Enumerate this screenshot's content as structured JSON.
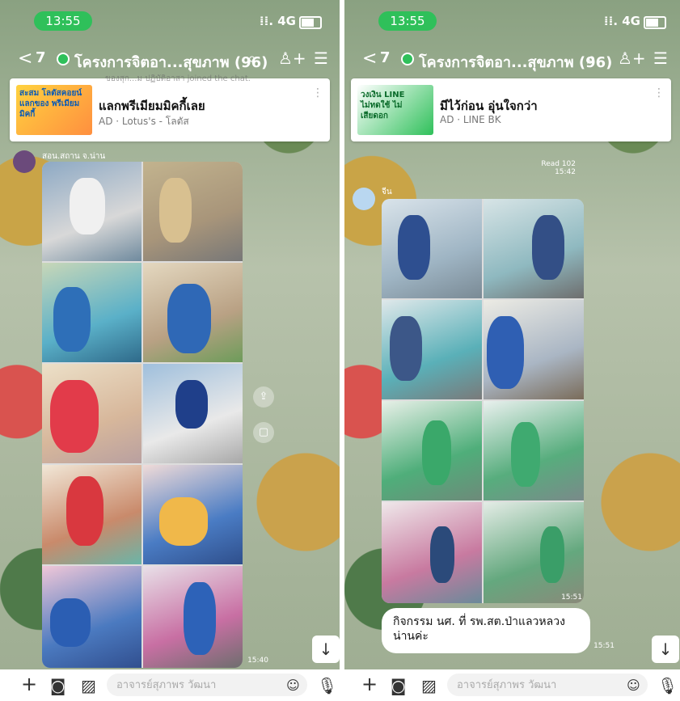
{
  "left": {
    "status": {
      "time": "13:55",
      "network": "4G"
    },
    "header": {
      "back_label": "<",
      "back_count": "7",
      "title": "โครงการจิตอา...สุขภาพ (96)"
    },
    "ad": {
      "title": "แลกพรีเมียมมิคกี้เลย",
      "sub": "AD · Lotus's - โลตัส",
      "overlay": "ของสุก...ม ปฏิบัติอาสา joined the chat.",
      "img_text": "สะสม โลตัสคอยน์ แลกของ พรีเมียมมิคกี้"
    },
    "sender": "สอน.สถาน จ.น่าน",
    "meta_time": "15:40",
    "scroll_label": "↓"
  },
  "right": {
    "status": {
      "time": "13:55",
      "network": "4G"
    },
    "header": {
      "back_label": "<",
      "back_count": "7",
      "title": "โครงการจิตอา...สุขภาพ (96)"
    },
    "ad": {
      "title": "มีไว้ก่อน อุ่นใจกว่า",
      "sub": "AD · LINE BK",
      "img_text": "วงเงิน LINE ไม่ทดใช้ ไม่เสียดอก"
    },
    "sender": "จีน",
    "read_meta": "Read 102",
    "read_time": "15:42",
    "photo_time": "15:51",
    "bubble_text": "กิจกรรม นศ. ที่ รพ.สต.ป่าแลวหลวง น่านค่ะ",
    "bubble_time": "15:51",
    "scroll_label": "↓"
  },
  "bottom": {
    "left_placeholder": "อาจารย์สุภาพร วัฒนา",
    "right_placeholder": "อาจารย์สุภาพร วัฒนา"
  },
  "colors": {
    "line_green": "#2fc05a"
  }
}
